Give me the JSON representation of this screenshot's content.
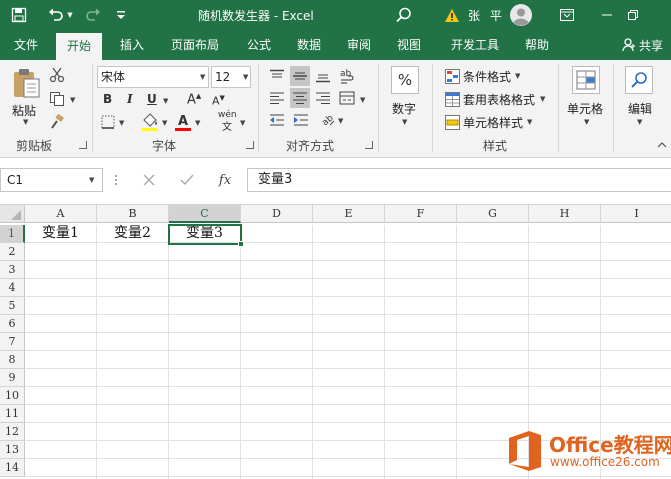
{
  "titlebar": {
    "document_title": "随机数发生器  -  Excel",
    "user_name": "张 平",
    "icons": [
      "save-icon",
      "undo-icon",
      "redo-icon",
      "customize-icon",
      "search-icon",
      "warning-icon",
      "avatar-icon",
      "ribbon-display-icon",
      "minimize-icon",
      "restore-icon"
    ]
  },
  "tabs": {
    "items": [
      {
        "label": "文件"
      },
      {
        "label": "开始",
        "active": true
      },
      {
        "label": "插入"
      },
      {
        "label": "页面布局"
      },
      {
        "label": "公式"
      },
      {
        "label": "数据"
      },
      {
        "label": "审阅"
      },
      {
        "label": "视图"
      },
      {
        "label": "开发工具"
      },
      {
        "label": "帮助"
      }
    ],
    "share": "共享"
  },
  "ribbon": {
    "clipboard": {
      "paste": "粘贴",
      "group": "剪贴板"
    },
    "font": {
      "name": "宋体",
      "size": "12",
      "bold": "B",
      "italic": "I",
      "underline": "U",
      "grow": "A",
      "shrink": "A",
      "font_color_letter": "A",
      "phonetic": "wén",
      "group": "字体"
    },
    "alignment": {
      "group": "对齐方式"
    },
    "number": {
      "percent": "%",
      "label": "数字"
    },
    "styles": {
      "conditional": "条件格式",
      "table": "套用表格格式",
      "cell": "单元格样式",
      "group": "样式"
    },
    "cells": {
      "label": "单元格"
    },
    "editing": {
      "label": "编辑"
    }
  },
  "formula_bar": {
    "name_box": "C1",
    "fx": "fx",
    "content": "变量3"
  },
  "grid": {
    "columns": [
      "A",
      "B",
      "C",
      "D",
      "E",
      "F",
      "G",
      "H",
      "I"
    ],
    "rows": [
      "1",
      "2",
      "3",
      "4",
      "5",
      "6",
      "7",
      "8",
      "9",
      "10",
      "11",
      "12",
      "13",
      "14"
    ],
    "selected_cell": "C1",
    "row1": [
      "变量1",
      "变量2",
      "变量3"
    ]
  },
  "watermark": {
    "title": "Office教程网",
    "url": "www.office26.com"
  },
  "colors": {
    "excel_green": "#217346",
    "ribbon_bg": "#f3f3f3",
    "watermark_orange": "#e0641f"
  }
}
